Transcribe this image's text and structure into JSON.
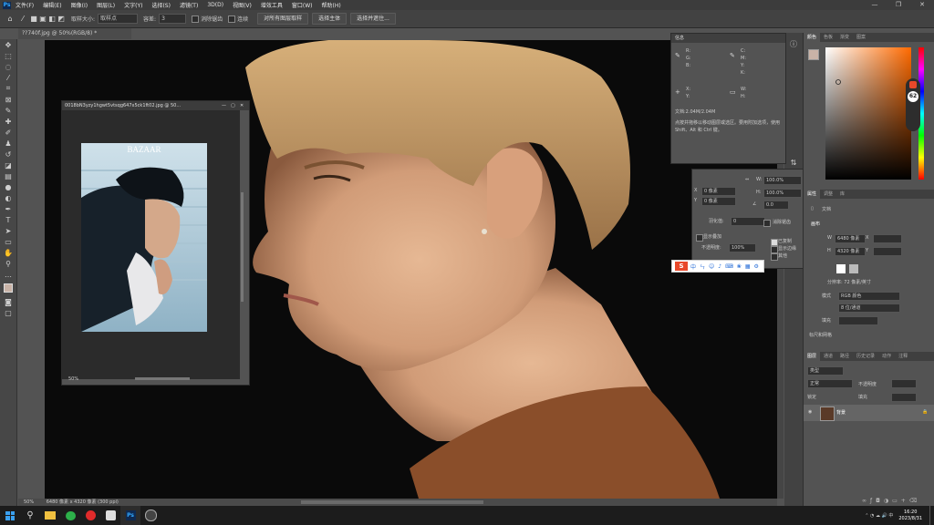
{
  "menubar": {
    "app_icon": "Ps",
    "items": [
      "文件(F)",
      "编辑(E)",
      "图像(I)",
      "图层(L)",
      "文字(Y)",
      "选择(S)",
      "滤镜(T)",
      "3D(D)",
      "视图(V)",
      "增效工具",
      "窗口(W)",
      "帮助(H)"
    ],
    "window_controls": [
      "—",
      "❐",
      "✕"
    ]
  },
  "options": {
    "size_label": "取样大小:",
    "size_value": "取样点",
    "tolerance_label": "容差:",
    "tolerance_value": "3",
    "antialias": "消除锯齿",
    "contiguous": "连续",
    "sample_all": "对所有图层取样",
    "select_subject": "选择主体",
    "select_mask": "选择并遮住..."
  },
  "document": {
    "tab_title": "??740f.jpg @ 50%(RGB/8) *",
    "status_zoom": "50%",
    "status_info": "6480 像素 x 4320 像素 (300 ppi)"
  },
  "float_window": {
    "title": "0018bN3yzy1hgwt5vtsqg647x5ck1ft02.jpg @ 50...",
    "zoom": "50%",
    "brand": "BAZAAR"
  },
  "info_panel": {
    "title": "信息",
    "r": "R:",
    "g": "G:",
    "b": "B:",
    "c": "C:",
    "m": "M:",
    "y": "Y:",
    "k": "K:",
    "x": "X:",
    "y2": "Y:",
    "w": "W:",
    "h": "H:",
    "doc_line": "文档:2.04M/2.04M",
    "hint": "点按并拖移以移动图层或选区。要用附加选项，使用 Shift、Alt 和 Ctrl 键。"
  },
  "props_float": {
    "w_label": "W:",
    "w_value": "100.0%",
    "h_label": "H:",
    "h_value": "100.0%",
    "x_value": "0 像素",
    "y_value": "0 像素",
    "angle": "0.0",
    "feather_label": "羽化值:",
    "feather_value": "0",
    "antialias": "消除锯齿",
    "show_overlay": "显示叠加",
    "opacity_label": "不透明度:",
    "opacity_value": "100%",
    "live_shape": "已复制",
    "edge": "显示边缘",
    "stroke": "其他"
  },
  "right_panel": {
    "color_tabs": [
      "颜色",
      "色板",
      "渐变",
      "图案"
    ],
    "hue_number": "62",
    "props_tabs": [
      "属性",
      "调整",
      "库"
    ],
    "doc_label": "文档",
    "canvas_label": "画布",
    "w_label": "W",
    "w_value": "6480 像素",
    "h_label": "H",
    "h_value": "4320 像素",
    "x_label": "X",
    "y_label": "Y",
    "resolution": "分辨率: 72 像素/英寸",
    "mode_label": "模式",
    "mode_value": "RGB 颜色",
    "bit_value": "8 位/通道",
    "fill_label": "填充",
    "rulers": "标尺和网格",
    "layer_tabs": [
      "图层",
      "通道",
      "路径",
      "历史记录",
      "动作",
      "注释"
    ],
    "kind_label": "类型",
    "blend_mode": "正常",
    "opacity": "不透明度",
    "lock_label": "锁定",
    "fill_label2": "填充",
    "layer_name": "背景"
  },
  "taskbar": {
    "time": "16:20",
    "date": "2023/8/31"
  },
  "colors": {
    "accent": "#31a8ff",
    "bg": "#535353",
    "panel_dark": "#3c3c3c"
  }
}
